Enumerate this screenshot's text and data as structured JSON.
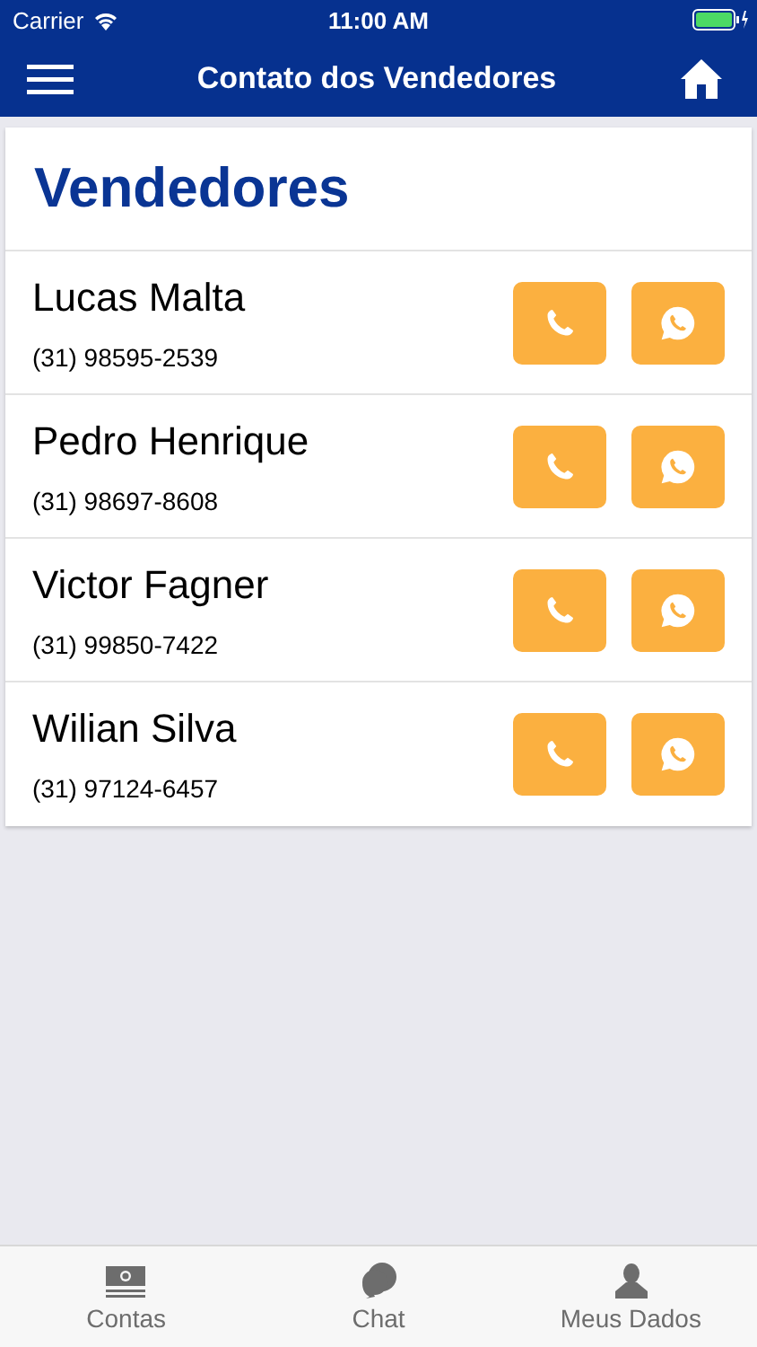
{
  "status_bar": {
    "carrier": "Carrier",
    "time": "11:00 AM"
  },
  "nav_bar": {
    "title": "Contato dos Vendedores"
  },
  "card": {
    "title": "Vendedores"
  },
  "sellers": [
    {
      "name": "Lucas Malta",
      "phone": "(31) 98595-2539"
    },
    {
      "name": "Pedro Henrique",
      "phone": "(31) 98697-8608"
    },
    {
      "name": "Victor Fagner",
      "phone": "(31) 99850-7422"
    },
    {
      "name": "Wilian Silva",
      "phone": "(31) 97124-6457"
    }
  ],
  "tab_bar": [
    {
      "label": "Contas",
      "kind": "money"
    },
    {
      "label": "Chat",
      "kind": "chat"
    },
    {
      "label": "Meus Dados",
      "kind": "person"
    }
  ]
}
